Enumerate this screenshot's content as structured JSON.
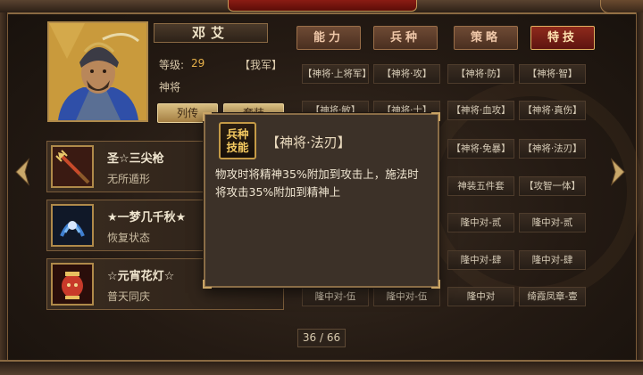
{
  "general": {
    "name": "邓艾",
    "level_label": "等级:",
    "level_value": "29",
    "army": "【我军】",
    "rank": "神将",
    "btn_biography": "列传",
    "btn_equip": "套装"
  },
  "items": [
    {
      "name": "圣☆三尖枪",
      "desc": "无所遁形",
      "icon": "spear-icon"
    },
    {
      "name": "★一梦几千秋★",
      "desc": "恢复状态",
      "icon": "dream-emblem-icon"
    },
    {
      "name": "☆元宵花灯☆",
      "desc": "普天同庆",
      "icon": "lantern-icon"
    }
  ],
  "tabs": [
    {
      "label": "能力",
      "active": false
    },
    {
      "label": "兵种",
      "active": false
    },
    {
      "label": "策略",
      "active": false
    },
    {
      "label": "特技",
      "active": true
    }
  ],
  "skills": [
    [
      "【神将·上将军】",
      "【神将·攻】",
      "【神将·防】",
      "【神将·智】"
    ],
    [
      "【神将·敏】",
      "【神将·士】",
      "【神将·血攻】",
      "【神将·真伤】"
    ],
    [
      "",
      "",
      "【神将·免暴】",
      "【神将·法刃】"
    ],
    [
      "",
      "",
      "神装五件套",
      "【攻智一体】"
    ],
    [
      "",
      "",
      "隆中对-贰",
      "隆中对-贰"
    ],
    [
      "",
      "",
      "隆中对-肆",
      "隆中对-肆"
    ],
    [
      "隆中对-伍",
      "隆中对-伍",
      "隆中对",
      "绮霞凤章-壹"
    ]
  ],
  "pager": "36 / 66",
  "tooltip": {
    "badge_line1": "兵种",
    "badge_line2": "技能",
    "title": "【神将·法刃】",
    "desc": "物攻时将精神35%附加到攻击上，施法时将攻击35%附加到精神上"
  },
  "colors": {
    "active_tab": "#8e2a1c",
    "level_value": "#e8b24a",
    "badge_text": "#f2c860"
  }
}
